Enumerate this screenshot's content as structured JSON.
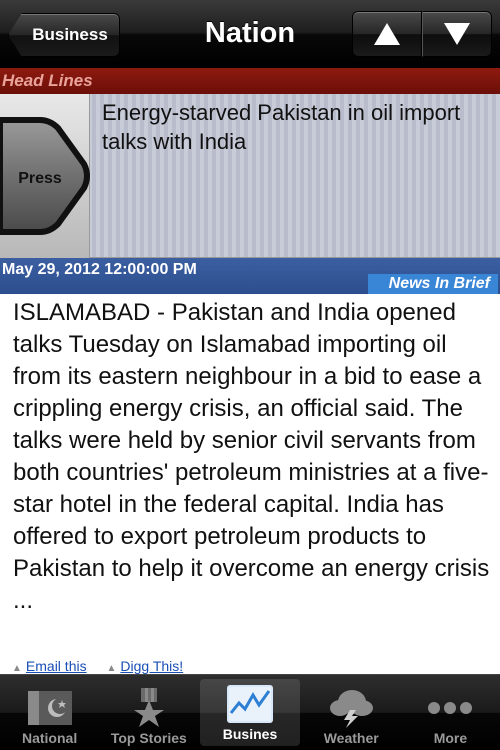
{
  "navbar": {
    "back_label": "Business",
    "title": "Nation",
    "up_icon": "arrow-up-icon",
    "down_icon": "arrow-down-icon"
  },
  "section": {
    "headlines_label": "Head Lines"
  },
  "headline": {
    "thumbnail_text": "Press",
    "title": "Energy-starved Pakistan in oil import talks with India"
  },
  "meta": {
    "date": "May 29, 2012 12:00:00 PM",
    "category": "News In Brief"
  },
  "article": {
    "body": "ISLAMABAD - Pakistan and India opened talks Tuesday on Islamabad importing oil from its eastern neighbour in a bid to ease a crippling energy crisis, an official said. The talks were held by senior civil servants from both countries' petroleum ministries at a five-star hotel in the federal capital. India has offered to export petroleum products to Pakistan to help it overcome an energy crisis ...",
    "email_link": "Email this",
    "digg_link": "Digg This!"
  },
  "tabs": [
    {
      "label": "National",
      "icon": "pakistan-flag-icon"
    },
    {
      "label": "Top Stories",
      "icon": "star-medal-icon"
    },
    {
      "label": "Busines",
      "icon": "stock-chart-icon"
    },
    {
      "label": "Weather",
      "icon": "cloud-lightning-icon"
    },
    {
      "label": "More",
      "icon": "more-dots-icon"
    }
  ],
  "colors": {
    "headlines_bar": "#7d150c",
    "date_bar": "#2f5394",
    "brief_tag": "#3a86d6",
    "link": "#1a4fb5"
  }
}
